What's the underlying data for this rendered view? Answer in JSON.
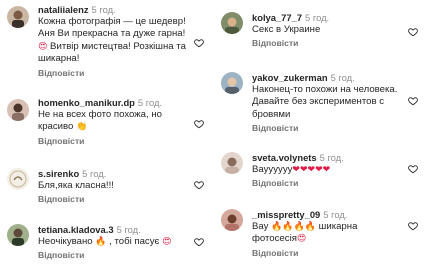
{
  "left_column": [
    {
      "username": "nataliialenz",
      "time": "5 год.",
      "lines": [
        "Кожна фотографія — це шедевр!",
        "Аня Ви прекрасна та дуже гарна!"
      ],
      "line3_text": " Витвір мистецтва! Розкішна та",
      "line4": "шикарна!",
      "reply": "Відповісти"
    },
    {
      "username": "homenko_manikur.dp",
      "time": "5 год.",
      "lines": [
        "Не на всех фото похожа, но"
      ],
      "line2_text": "красиво ",
      "reply": "Відповісти"
    },
    {
      "username": "s.sirenko",
      "time": "5 год.",
      "lines": [
        "Бля,яка класна!!!"
      ],
      "reply": "Відповісти"
    },
    {
      "username": "tetiana.kladova.3",
      "time": "5 год.",
      "line1_a": "Неочікувано ",
      "line1_b": " , тобі пасує ",
      "reply": "Відповісти"
    }
  ],
  "right_column": [
    {
      "username": "kolya_77_7",
      "time": "5 год.",
      "lines": [
        "Секс в Украине"
      ],
      "reply": "Відповісти"
    },
    {
      "username": "yakov_zukerman",
      "time": "5 год.",
      "lines": [
        "Наконец-то похожи на человека.",
        "Давайте без экспериментов с",
        "бровями"
      ],
      "reply": "Відповісти"
    },
    {
      "username": "sveta.volynets",
      "time": "5 год.",
      "line1_text": "Вауууууу",
      "reply": "Відповісти"
    },
    {
      "username": "_misspretty_09",
      "time": "5 год.",
      "line1_a": "Вау ",
      "line1_b": " шикарна фотосесія",
      "line1_c": "",
      "reply": "Відповісти"
    }
  ],
  "icons": {
    "heart_outline": "heart-icon",
    "emoji_heart_eyes": "smiling-face-with-heart-eyes",
    "emoji_fire": "fire-icon",
    "emoji_red_heart": "red-heart-icon",
    "emoji_thumbs": "hands-icon"
  },
  "colors": {
    "username": "#262626",
    "meta": "#8e8e8e",
    "reply": "#737373"
  }
}
